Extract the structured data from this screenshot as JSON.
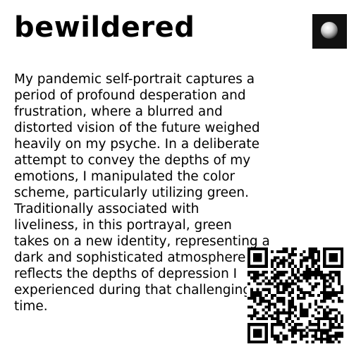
{
  "title": "bewildered",
  "description_lines": [
    "My pandemic self-portrait captures a",
    "period of profound desperation and",
    "frustration, where a blurred and",
    "distorted vision of the future weighed",
    "heavily on my psyche. In a deliberate",
    "attempt to convey the depths of my",
    "emotions, I manipulated the color",
    "scheme, particularly utilizing green.",
    "Traditionally associated with",
    "liveliness, in this portrayal, green",
    "takes on a new identity, representing a",
    "dark and sophisticated atmosphere that",
    "reflects the depths of depression I",
    "experienced during that challenging",
    "time."
  ],
  "icons": {
    "thumbnail": "artwork-thumbnail",
    "qr": "qr-code"
  }
}
